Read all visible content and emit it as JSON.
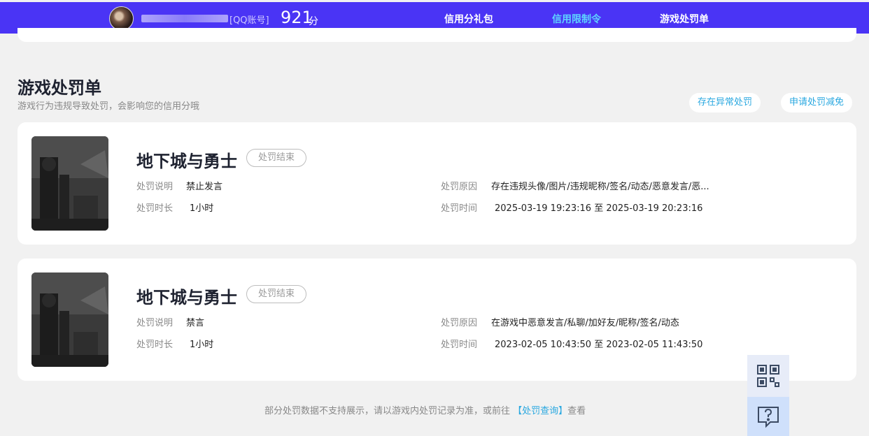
{
  "header": {
    "account_tag": "[QQ账号]",
    "score": "921",
    "score_unit": "分",
    "nav": [
      "信用分礼包",
      "信用限制令",
      "游戏处罚单"
    ],
    "active_nav_index": 1
  },
  "section": {
    "title": "游戏处罚单",
    "subtitle": "游戏行为违规导致处罚，会影响您的信用分哦",
    "btn_abnormal": "存在异常处罚",
    "btn_appeal": "申请处罚减免"
  },
  "labels": {
    "desc": "处罚说明",
    "duration": "处罚时长",
    "reason": "处罚原因",
    "time": "处罚时间"
  },
  "records": [
    {
      "game": "地下城与勇士",
      "status": "处罚结束",
      "desc": "禁止发言",
      "duration": "1小时",
      "reason": "存在违规头像/图片/违规昵称/签名/动态/恶意发言/恶...",
      "time": "2025-03-19 19:23:16 至 2025-03-19 20:23:16"
    },
    {
      "game": "地下城与勇士",
      "status": "处罚结束",
      "desc": "禁言",
      "duration": "1小时",
      "reason": "在游戏中恶意发言/私聊/加好友/昵称/签名/动态",
      "time": "2023-02-05 10:43:50 至 2023-02-05 11:43:50"
    }
  ],
  "footer": {
    "prefix": "部分处罚数据不支持展示，请以游戏内处罚记录为准，或前往 ",
    "link": "【处罚查询】",
    "suffix": "查看"
  },
  "icons": {
    "qr": "qr-code-icon",
    "feedback": "feedback-question-icon"
  },
  "colors": {
    "brand": "#4a34f5",
    "accent": "#5ed4ff",
    "link": "#2aa8e0"
  }
}
